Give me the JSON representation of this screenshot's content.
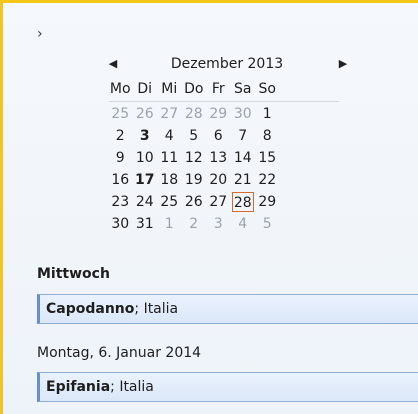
{
  "calendar": {
    "month_title": "Dezember 2013",
    "weekdays": [
      "Mo",
      "Di",
      "Mi",
      "Do",
      "Fr",
      "Sa",
      "So"
    ],
    "weeks": [
      [
        {
          "d": "25",
          "m": true
        },
        {
          "d": "26",
          "m": true
        },
        {
          "d": "27",
          "m": true
        },
        {
          "d": "28",
          "m": true
        },
        {
          "d": "29",
          "m": true
        },
        {
          "d": "30",
          "m": true
        },
        {
          "d": "1"
        }
      ],
      [
        {
          "d": "2"
        },
        {
          "d": "3",
          "b": true
        },
        {
          "d": "4"
        },
        {
          "d": "5"
        },
        {
          "d": "6"
        },
        {
          "d": "7"
        },
        {
          "d": "8"
        }
      ],
      [
        {
          "d": "9"
        },
        {
          "d": "10"
        },
        {
          "d": "11"
        },
        {
          "d": "12"
        },
        {
          "d": "13"
        },
        {
          "d": "14"
        },
        {
          "d": "15"
        }
      ],
      [
        {
          "d": "16"
        },
        {
          "d": "17",
          "b": true
        },
        {
          "d": "18"
        },
        {
          "d": "19"
        },
        {
          "d": "20"
        },
        {
          "d": "21"
        },
        {
          "d": "22"
        }
      ],
      [
        {
          "d": "23"
        },
        {
          "d": "24"
        },
        {
          "d": "25"
        },
        {
          "d": "26"
        },
        {
          "d": "27"
        },
        {
          "d": "28",
          "t": true
        },
        {
          "d": "29"
        }
      ],
      [
        {
          "d": "30"
        },
        {
          "d": "31"
        },
        {
          "d": "1",
          "m": true
        },
        {
          "d": "2",
          "m": true
        },
        {
          "d": "3",
          "m": true
        },
        {
          "d": "4",
          "m": true
        },
        {
          "d": "5",
          "m": true
        }
      ]
    ]
  },
  "agenda": {
    "day1_label": "Mittwoch",
    "day1_item": {
      "subject": "Capodanno",
      "location": "Italia"
    },
    "day2_label": "Montag, 6. Januar 2014",
    "day2_item": {
      "subject": "Epifania",
      "location": "Italia"
    }
  }
}
